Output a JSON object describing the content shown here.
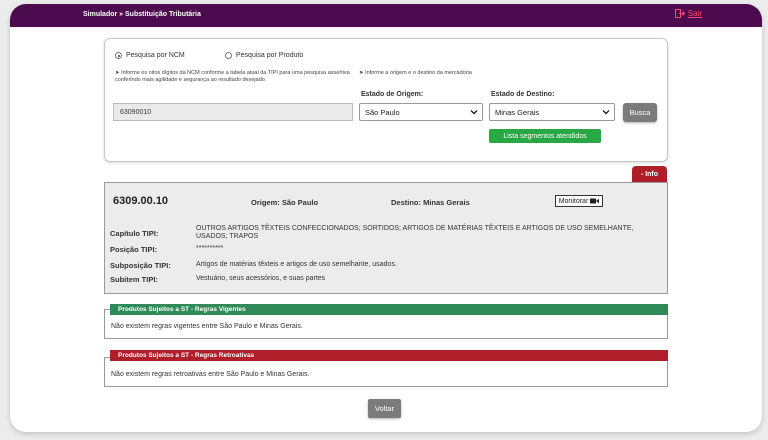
{
  "header": {
    "breadcrumb": "Simulador » Substituição Tributária",
    "exit_label": "Sair"
  },
  "search": {
    "mode_ncm_label": "Pesquisa por NCM",
    "mode_product_label": "Pesquisa por Produto",
    "selected_mode": "ncm",
    "ncm_hint": "➤ Informe os oitos dígitos da NCM conforme a tabela atual da TIPI para uma pesquisa assertiva conferindo mais agilidade e segurança ao resultado desejado.",
    "location_hint": "➤ Informe a origem e o destino da mercadoria",
    "ncm_value": "63090010",
    "origin_label": "Estado de Origem:",
    "origin_value": "São Paulo",
    "destination_label": "Estado de Destino:",
    "destination_value": "Minas Gerais",
    "search_button": "Busca",
    "segments_button": "Lista segmentos atendidos"
  },
  "info": {
    "tab_label": "- Info",
    "ncm_code": "6309.00.10",
    "origin": "Origem: São Paulo",
    "destination": "Destino: Minas Gerais",
    "monitor_button": "Monitorar",
    "rows": [
      {
        "label": "Capítulo TIPI:",
        "value": "OUTROS ARTIGOS TÊXTEIS CONFECCIONADOS; SORTIDOS; ARTIGOS DE MATÉRIAS TÊXTEIS E ARTIGOS DE USO SEMELHANTE, USADOS; TRAPOS"
      },
      {
        "label": "Posição TIPI:",
        "value": "**********"
      },
      {
        "label": "Subposição TIPI:",
        "value": "Artigos de matérias têxteis e artigos de uso semelhante, usados."
      },
      {
        "label": "Subitem TIPI:",
        "value": "Vestuário, seus acessórios, e suas partes"
      }
    ]
  },
  "rules": {
    "current_title": "Produtos Sujeitos a ST - Regras Vigentes",
    "current_message": "Não existem regras vigentes entre São Paulo e Minas Gerais.",
    "current_color": "#2f8a57",
    "retro_title": "Produtos Sujeitos a ST - Regras Retroativas",
    "retro_message": "Não existem regras retroativas entre São Paulo e Minas Gerais.",
    "retro_color": "#b01e2a"
  },
  "footer": {
    "back_button": "Voltar"
  }
}
